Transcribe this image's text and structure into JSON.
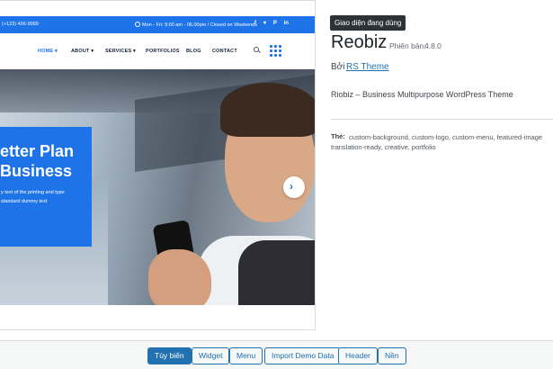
{
  "preview": {
    "topbar": {
      "contact": "(+123) 456-9989",
      "hours": "Mon - Fri: 9:00 am - 06.00pm / Closed on Weekends",
      "social": [
        "f",
        "♥",
        "P",
        "in"
      ]
    },
    "nav": {
      "items": [
        "HOME ▾",
        "ABOUT ▾",
        "SERVICES ▾",
        "PORTFOLIOS",
        "BLOG",
        "CONTACT"
      ]
    },
    "hero": {
      "title_line1": "etter Plan",
      "title_line2": " Business",
      "subtitle_line1": "y text of the printing and type",
      "subtitle_line2": "standard dummy text",
      "next_glyph": "›"
    }
  },
  "details": {
    "badge": "Giao diện đang dùng",
    "name": "Reobiz",
    "version_label": "Phiên bản:",
    "version": "4.8.0",
    "by_label": "Bởi",
    "author": "RS Theme",
    "description": "Riobiz – Business Multipurpose WordPress Theme",
    "tags_label": "Thẻ:",
    "tags_line1": "custom-background, custom-logo, custom-menu, featured-image",
    "tags_line2": "translation-ready, creative, portfolio"
  },
  "footer": {
    "buttons": [
      "Tùy biến",
      "Widget",
      "Menu",
      "Import Demo Data",
      "Header",
      "Nền"
    ]
  },
  "colors": {
    "accent": "#1e73e8",
    "wp_blue": "#2271b1",
    "badge_bg": "#2c3338"
  }
}
